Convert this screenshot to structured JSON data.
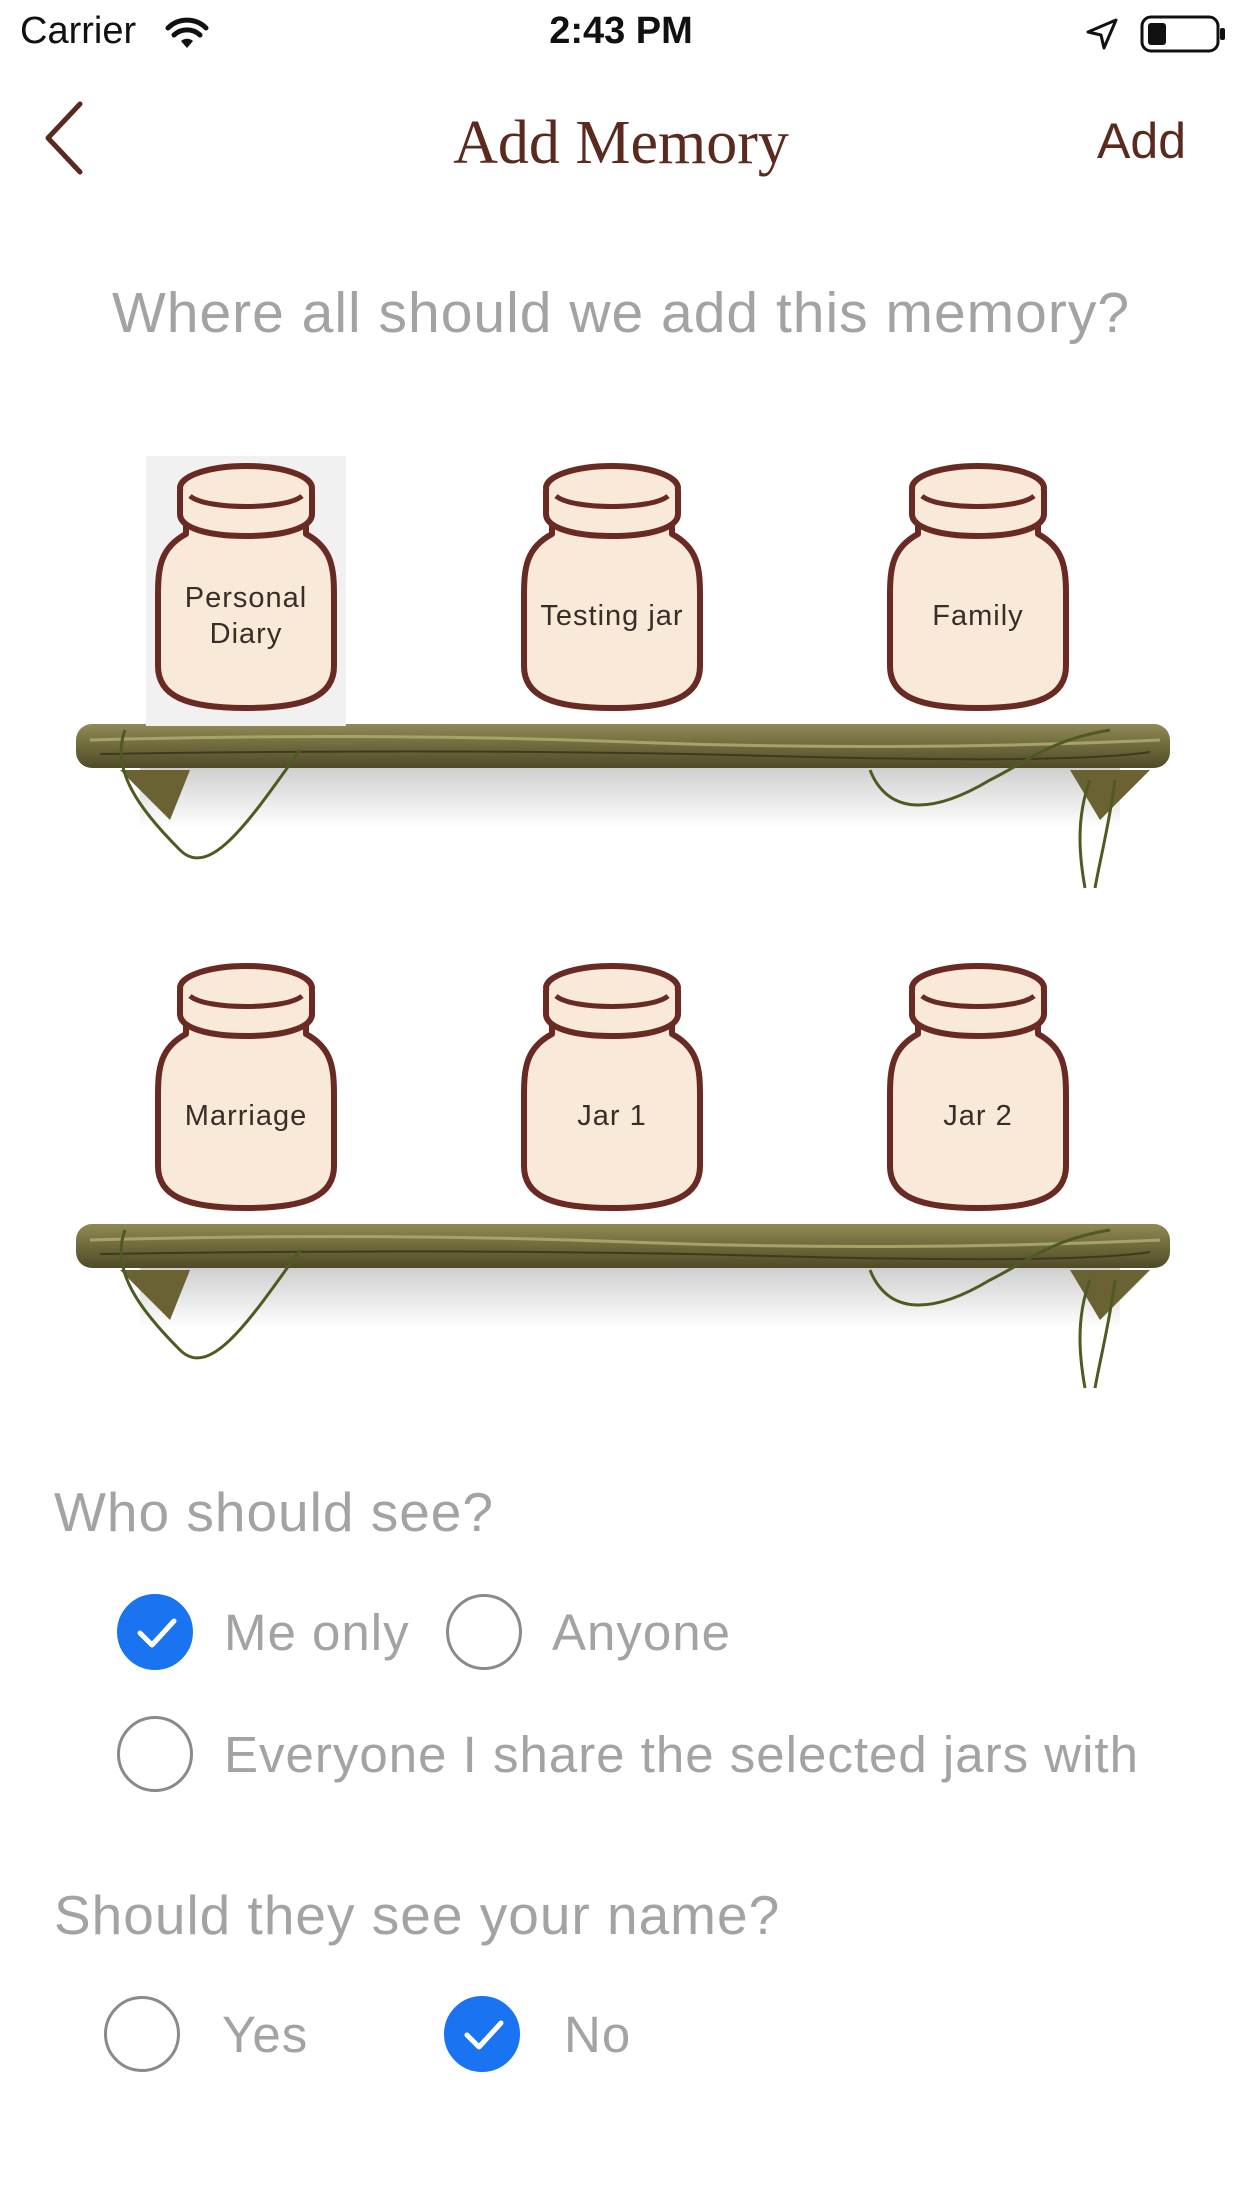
{
  "status_bar": {
    "carrier": "Carrier",
    "time": "2:43 PM"
  },
  "nav": {
    "title": "Add Memory",
    "add_label": "Add"
  },
  "prompt": "Where all should we add this memory?",
  "jars": [
    {
      "label": "Personal Diary",
      "selected": true
    },
    {
      "label": "Testing jar",
      "selected": false
    },
    {
      "label": "Family",
      "selected": false
    },
    {
      "label": "Marriage",
      "selected": false
    },
    {
      "label": "Jar 1",
      "selected": false
    },
    {
      "label": "Jar 2",
      "selected": false
    }
  ],
  "visibility": {
    "question": "Who should see?",
    "options": [
      {
        "label": "Me only",
        "checked": true
      },
      {
        "label": "Anyone",
        "checked": false
      },
      {
        "label": "Everyone I share the selected jars with",
        "checked": false
      }
    ]
  },
  "show_name": {
    "question": "Should they see your name?",
    "options": [
      {
        "label": "Yes",
        "checked": false
      },
      {
        "label": "No",
        "checked": true
      }
    ]
  },
  "colors": {
    "accent": "#1a73f0",
    "title_brown": "#5a2a1e",
    "jar_fill": "#f8e9d9",
    "jar_stroke": "#6a2a24",
    "muted_text": "#a3a3a3"
  }
}
